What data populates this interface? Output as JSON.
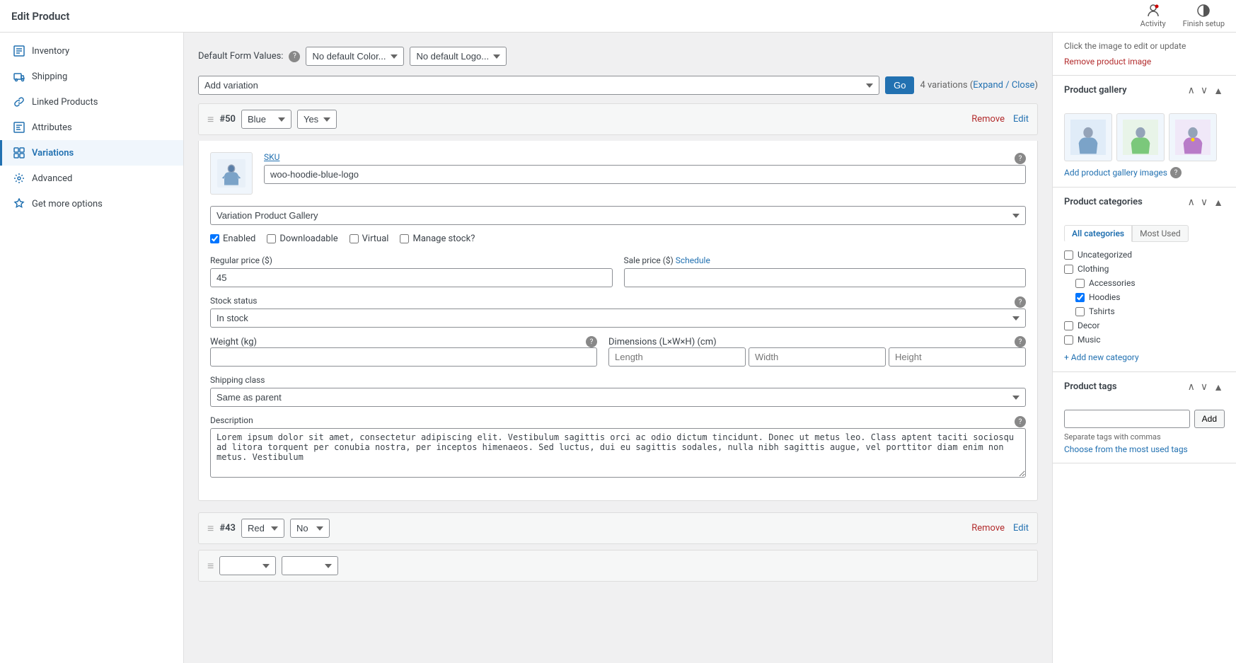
{
  "page": {
    "title": "Edit Product"
  },
  "topbar": {
    "title": "Edit Product",
    "activity_label": "Activity",
    "finish_setup_label": "Finish setup"
  },
  "sidebar": {
    "items": [
      {
        "id": "inventory",
        "label": "Inventory",
        "icon": "inventory-icon"
      },
      {
        "id": "shipping",
        "label": "Shipping",
        "icon": "shipping-icon"
      },
      {
        "id": "linked-products",
        "label": "Linked Products",
        "icon": "link-icon"
      },
      {
        "id": "attributes",
        "label": "Attributes",
        "icon": "attributes-icon"
      },
      {
        "id": "variations",
        "label": "Variations",
        "icon": "variations-icon",
        "active": true
      },
      {
        "id": "advanced",
        "label": "Advanced",
        "icon": "advanced-icon"
      },
      {
        "id": "get-more-options",
        "label": "Get more options",
        "icon": "star-icon"
      }
    ]
  },
  "main": {
    "default_form_values_label": "Default Form Values:",
    "color_default_label": "No default Color...",
    "logo_default_label": "No default Logo...",
    "add_variation_label": "Add variation",
    "go_button": "Go",
    "variations_count": "4 variations (Expand / Close)",
    "variation_50": {
      "number": "#50",
      "color_value": "Blue",
      "yes_no_value": "Yes",
      "remove_label": "Remove",
      "edit_label": "Edit",
      "sku_label": "SKU",
      "sku_value": "woo-hoodie-blue-logo",
      "gallery_placeholder": "Variation Product Gallery",
      "enabled_label": "Enabled",
      "downloadable_label": "Downloadable",
      "virtual_label": "Virtual",
      "manage_stock_label": "Manage stock?",
      "regular_price_label": "Regular price ($)",
      "regular_price_value": "45",
      "sale_price_label": "Sale price ($)",
      "schedule_label": "Schedule",
      "stock_status_label": "Stock status",
      "stock_status_value": "In stock",
      "weight_label": "Weight (kg)",
      "dimensions_label": "Dimensions (L×W×H) (cm)",
      "length_placeholder": "Length",
      "width_placeholder": "Width",
      "height_placeholder": "Height",
      "shipping_class_label": "Shipping class",
      "shipping_class_value": "Same as parent",
      "description_label": "Description",
      "description_value": "Lorem ipsum dolor sit amet, consectetur adipiscing elit. Vestibulum sagittis orci ac odio dictum tincidunt. Donec ut metus leo. Class aptent taciti sociosqu ad litora torquent per conubia nostra, per inceptos himenaeos. Sed luctus, dui eu sagittis sodales, nulla nibh sagittis augue, vel porttitor diam enim non metus. Vestibulum"
    },
    "variation_43": {
      "number": "#43",
      "color_value": "Red",
      "yes_no_value": "No",
      "remove_label": "Remove",
      "edit_label": "Edit"
    }
  },
  "right_panel": {
    "product_image_hint": "Click the image to edit or update",
    "remove_image_label": "Remove product image",
    "gallery_section": {
      "title": "Product gallery",
      "add_label": "Add product gallery images"
    },
    "categories_section": {
      "title": "Product categories",
      "all_categories_tab": "All categories",
      "most_used_tab": "Most Used",
      "categories": [
        {
          "id": "uncategorized",
          "label": "Uncategorized",
          "checked": false,
          "sub": false
        },
        {
          "id": "clothing",
          "label": "Clothing",
          "checked": false,
          "sub": false
        },
        {
          "id": "accessories",
          "label": "Accessories",
          "checked": false,
          "sub": true
        },
        {
          "id": "hoodies",
          "label": "Hoodies",
          "checked": true,
          "sub": true
        },
        {
          "id": "tshirts",
          "label": "Tshirts",
          "checked": false,
          "sub": true
        },
        {
          "id": "decor",
          "label": "Decor",
          "checked": false,
          "sub": false
        },
        {
          "id": "music",
          "label": "Music",
          "checked": false,
          "sub": false
        }
      ],
      "add_new_label": "+ Add new category"
    },
    "tags_section": {
      "title": "Product tags",
      "add_button": "Add",
      "separator_hint": "Separate tags with commas",
      "most_used_label": "Choose from the most used tags"
    }
  }
}
